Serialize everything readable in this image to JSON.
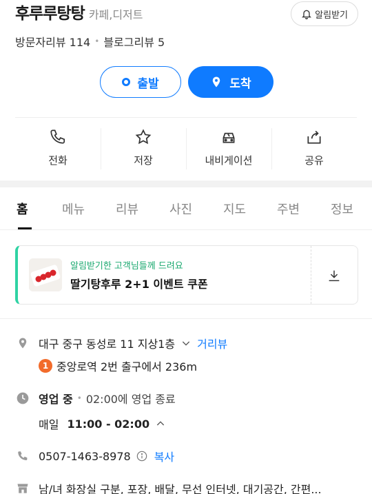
{
  "place": {
    "name": "후루루탕탕",
    "category": "카페,디저트",
    "notify_label": "알림받기"
  },
  "reviews": {
    "visitor": "방문자리뷰 114",
    "blog": "블로그리뷰 5"
  },
  "route": {
    "start_label": "출발",
    "arrive_label": "도착"
  },
  "actions": [
    {
      "label": "전화",
      "icon": "phone-icon"
    },
    {
      "label": "저장",
      "icon": "star-icon"
    },
    {
      "label": "내비게이션",
      "icon": "car-icon"
    },
    {
      "label": "공유",
      "icon": "share-icon"
    }
  ],
  "tabs": [
    "홈",
    "메뉴",
    "리뷰",
    "사진",
    "지도",
    "주변",
    "정보"
  ],
  "coupon": {
    "subtitle": "알림받기한 고객님들께 드려요",
    "title": "딸기탕후루 2+1 이벤트 쿠폰"
  },
  "info": {
    "address": "대구 중구 동성로 11 지상1층",
    "distance_link": "거리뷰",
    "station_number": "1",
    "station_text": "중앙로역 2번 출구에서 236m",
    "status": "영업 중",
    "status_detail": "02:00에 영업 종료",
    "hours_day": "매일",
    "hours_time": "11:00 - 02:00",
    "phone": "0507-1463-8978",
    "copy_label": "복사",
    "amenities": "남/녀 화장실 구분, 포장, 배달, 무선 인터넷, 대기공간, 간편..."
  },
  "colors": {
    "accent": "#0f7bff",
    "coupon_bar": "#2fd3a4",
    "badge": "#f26b2a"
  }
}
